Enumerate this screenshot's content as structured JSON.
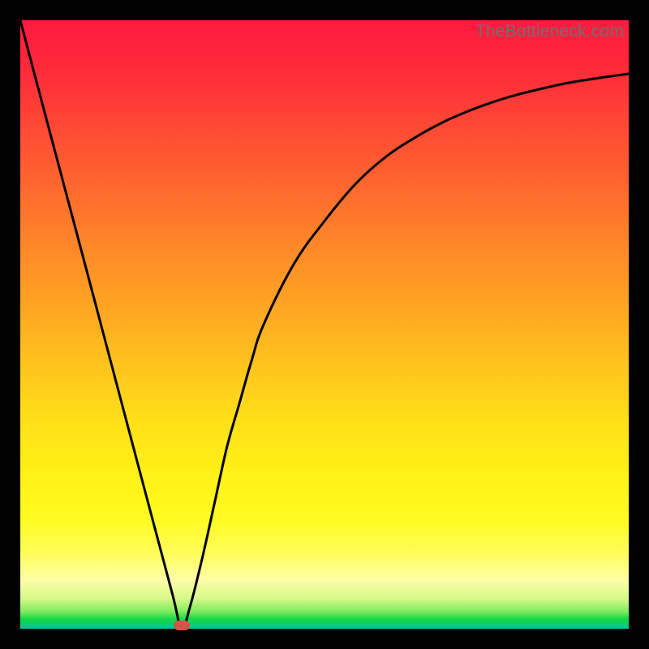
{
  "watermark": "TheBottleneck.com",
  "colors": {
    "frame": "#000000",
    "curve": "#000000",
    "marker": "#d35448",
    "gradient_top": "#ff1a40",
    "gradient_mid": "#ffe018",
    "gradient_bottom": "#09c2a8"
  },
  "chart_data": {
    "type": "line",
    "title": "",
    "xlabel": "",
    "ylabel": "",
    "xlim": [
      0,
      100
    ],
    "ylim": [
      0,
      100
    ],
    "grid": false,
    "series": [
      {
        "name": "bottleneck-curve",
        "x": [
          0,
          5,
          10,
          15,
          20,
          25,
          26.5,
          28,
          30,
          32,
          34,
          36,
          38,
          40,
          45,
          50,
          55,
          60,
          65,
          70,
          75,
          80,
          85,
          90,
          95,
          100
        ],
        "values": [
          100,
          81.1,
          62.3,
          43.4,
          24.5,
          5.7,
          0,
          4,
          12,
          21,
          30,
          37,
          44,
          50,
          60,
          67,
          73,
          77.5,
          80.8,
          83.5,
          85.6,
          87.3,
          88.6,
          89.7,
          90.5,
          91.2
        ]
      }
    ],
    "marker": {
      "x": 26.5,
      "y": 0
    },
    "annotations": []
  }
}
